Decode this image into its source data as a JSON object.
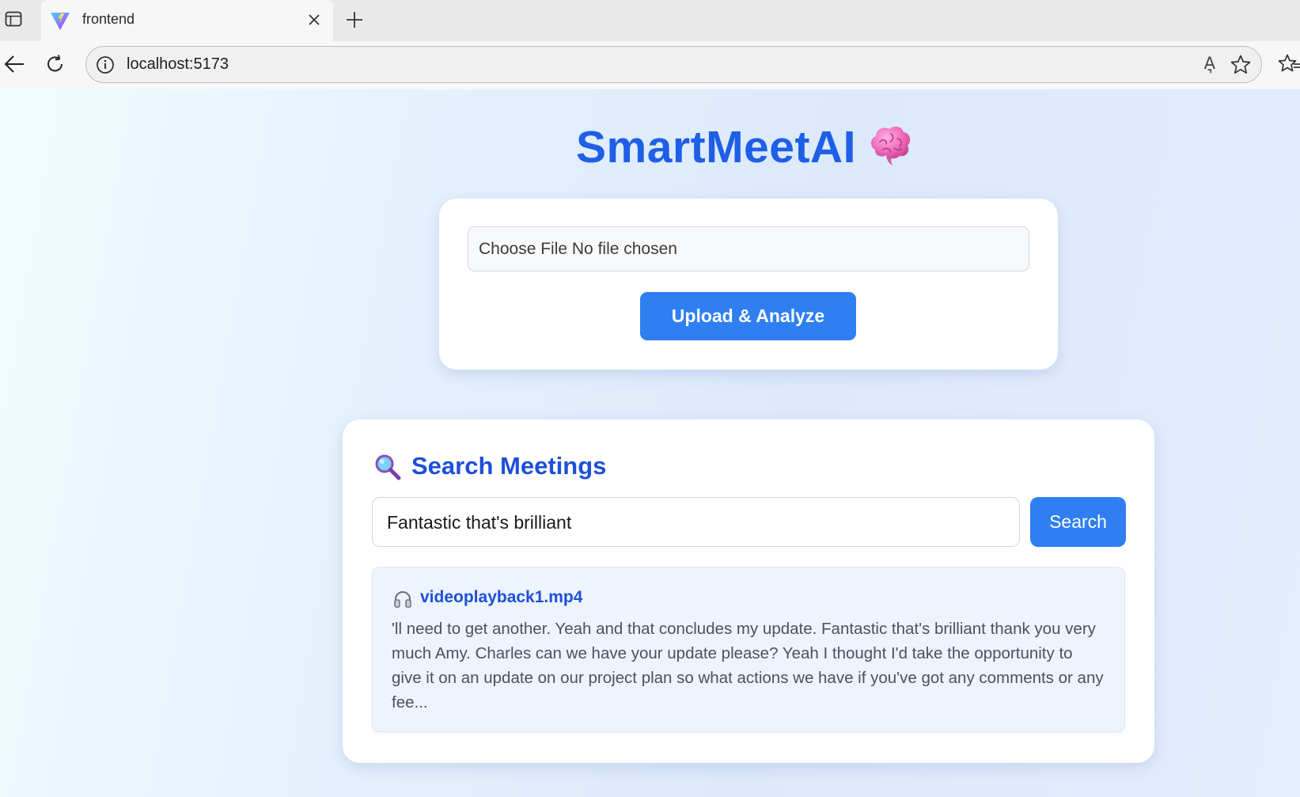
{
  "browser": {
    "tab": {
      "title": "frontend"
    },
    "address": {
      "url": "localhost:5173"
    },
    "read_aloud_label": "A͉"
  },
  "app": {
    "title": "SmartMeetAI",
    "upload": {
      "file_input_text": "Choose File No file chosen",
      "button_label": "Upload & Analyze"
    },
    "search": {
      "heading": "Search Meetings",
      "input_value": "Fantastic that's brilliant",
      "button_label": "Search",
      "results": [
        {
          "filename": "videoplayback1.mp4",
          "snippet": "'ll need to get another. Yeah and that concludes my update. Fantastic that's brilliant thank you very much Amy. Charles can we have your update please? Yeah I thought I'd take the opportunity to give it on an update on our project plan so what actions we have if you've got any comments or any fee..."
        }
      ]
    }
  },
  "icons": {
    "sidebar": "sidebar-icon",
    "favicon": "vite-logo-icon",
    "close": "close-icon",
    "new_tab": "plus-icon",
    "back": "back-arrow-icon",
    "refresh": "refresh-icon",
    "info": "info-icon",
    "favorite": "star-icon",
    "favorites_list": "favorites-list-icon",
    "brain": "brain-icon",
    "search": "magnifier-icon",
    "result": "headphone-icon"
  },
  "colors": {
    "accent": "#2f7ff2",
    "heading_blue": "#1d4fd9",
    "title_blue": "#1f5ee6",
    "result_bg": "#edf4fe"
  }
}
